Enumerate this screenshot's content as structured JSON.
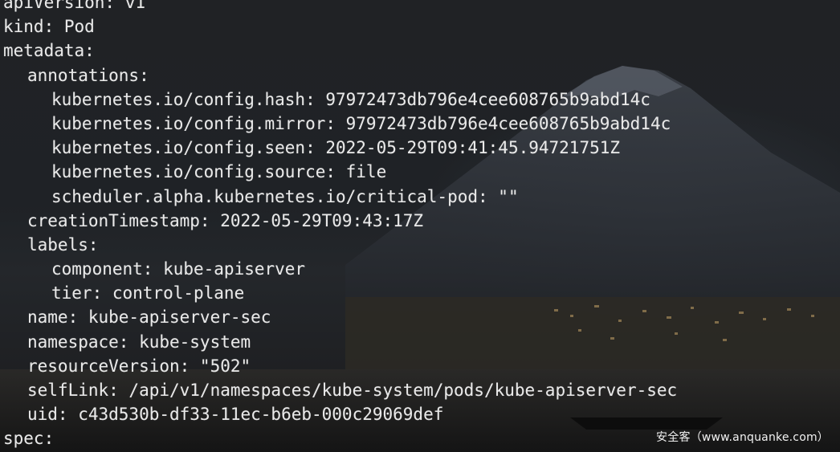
{
  "terminal": {
    "lines": [
      "apiVersion: v1",
      "kind: Pod",
      "metadata:",
      "annotations:",
      "kubernetes.io/config.hash: 97972473db796e4cee608765b9abd14c",
      "kubernetes.io/config.mirror: 97972473db796e4cee608765b9abd14c",
      "kubernetes.io/config.seen: 2022-05-29T09:41:45.94721751Z",
      "kubernetes.io/config.source: file",
      "scheduler.alpha.kubernetes.io/critical-pod: \"\"",
      "creationTimestamp: 2022-05-29T09:43:17Z",
      "labels:",
      "component: kube-apiserver",
      "tier: control-plane",
      "name: kube-apiserver-sec",
      "namespace: kube-system",
      "resourceVersion: \"502\"",
      "selfLink: /api/v1/namespaces/kube-system/pods/kube-apiserver-sec",
      "uid: c43d530b-df33-11ec-b6eb-000c29069def",
      "spec:"
    ]
  },
  "watermark": {
    "text": "安全客（www.anquanke.com）"
  },
  "colors": {
    "text": "#e9e9e9",
    "background": "#1f2226"
  }
}
